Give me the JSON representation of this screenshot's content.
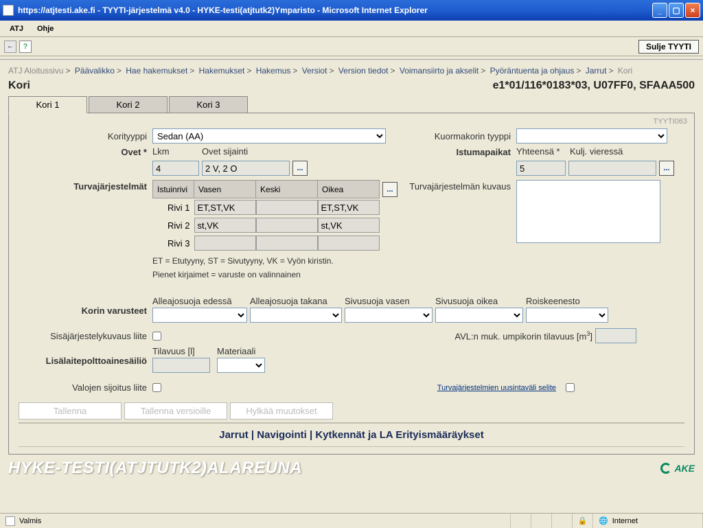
{
  "window": {
    "title": "https://atjtesti.ake.fi - TYYTI-järjestelmä v4.0 - HYKE-testi(atjtutk2)Ymparisto - Microsoft Internet Explorer"
  },
  "menubar": {
    "atj": "ATJ",
    "ohje": "Ohje"
  },
  "toolbar": {
    "back": "←",
    "help": "?",
    "sulje": "Sulje TYYTI"
  },
  "breadcrumb": {
    "items": [
      "ATJ Aloitussivu",
      "Päävalikko",
      "Hae hakemukset",
      "Hakemukset",
      "Hakemus",
      "Versiot",
      "Version tiedot",
      "Voimansiirto ja akselit",
      "Pyöräntuenta ja ohjaus",
      "Jarrut",
      "Kori"
    ]
  },
  "header": {
    "title": "Kori",
    "ref": "e1*01/116*0183*03, U07FF0, SFAAA500"
  },
  "tabs": [
    "Kori 1",
    "Kori 2",
    "Kori 3"
  ],
  "panel": {
    "code": "TYYTI063",
    "labels": {
      "korityyppi": "Korityyppi",
      "kuormakorin": "Kuormakorin tyyppi",
      "ovet": "Ovet *",
      "lkm": "Lkm",
      "ovet_sij": "Ovet sijainti",
      "istumapaikat": "Istumapaikat",
      "yhteensa": "Yhteensä *",
      "kulj": "Kulj. vieressä",
      "turva": "Turvajärjestelmät",
      "turva_kuvaus": "Turvajärjestelmän kuvaus",
      "istuinrivi": "Istuinrivi",
      "vasen": "Vasen",
      "keski": "Keski",
      "oikea": "Oikea",
      "rivi1": "Rivi 1",
      "rivi2": "Rivi 2",
      "rivi3": "Rivi 3",
      "legend1": "ET = Etutyyny, ST = Sivutyyny, VK = Vyön kiristin.",
      "legend2": "Pienet kirjaimet = varuste on valinnainen",
      "korin_var": "Korin varusteet",
      "ae": "Alleajosuoja edessä",
      "at": "Alleajosuoja takana",
      "sv": "Sivusuoja vasen",
      "so": "Sivusuoja oikea",
      "re": "Roiskeenesto",
      "sisa": "Sisäjärjestelykuvaus liite",
      "avl": "AVL:n muk. umpikorin tilavuus [m",
      "avl_sup": "3",
      "avl_end": "]",
      "lisa": "Lisälaitepolttoainesäiliö",
      "tilavuus": "Tilavuus [l]",
      "materiaali": "Materiaali",
      "valojen": "Valojen sijoitus liite",
      "turva_selite": "Turvajärjestelmien uusintaväli selite"
    },
    "values": {
      "korityyppi": "Sedan (AA)",
      "lkm": "4",
      "ovet_sij": "2 V, 2 O",
      "yhteensa": "5",
      "kulj": "",
      "safety": {
        "r1": {
          "v": "ET,ST,VK",
          "k": "",
          "o": "ET,ST,VK"
        },
        "r2": {
          "v": "st,VK",
          "k": "",
          "o": "st,VK"
        },
        "r3": {
          "v": "",
          "k": "",
          "o": ""
        }
      },
      "avl": "",
      "tilavuus": ""
    },
    "buttons": {
      "tallenna": "Tallenna",
      "tallenna_v": "Tallenna versioille",
      "hylkaa": "Hylkää muutokset"
    },
    "bottomnav": "Jarrut | Navigointi | Kytkennät ja LA Erityismääräykset"
  },
  "footer": {
    "env": "HYKE-TESTI(ATJTUTK2)ALAREUNA",
    "brand": "AKE"
  },
  "statusbar": {
    "ready": "Valmis",
    "zone": "Internet"
  }
}
